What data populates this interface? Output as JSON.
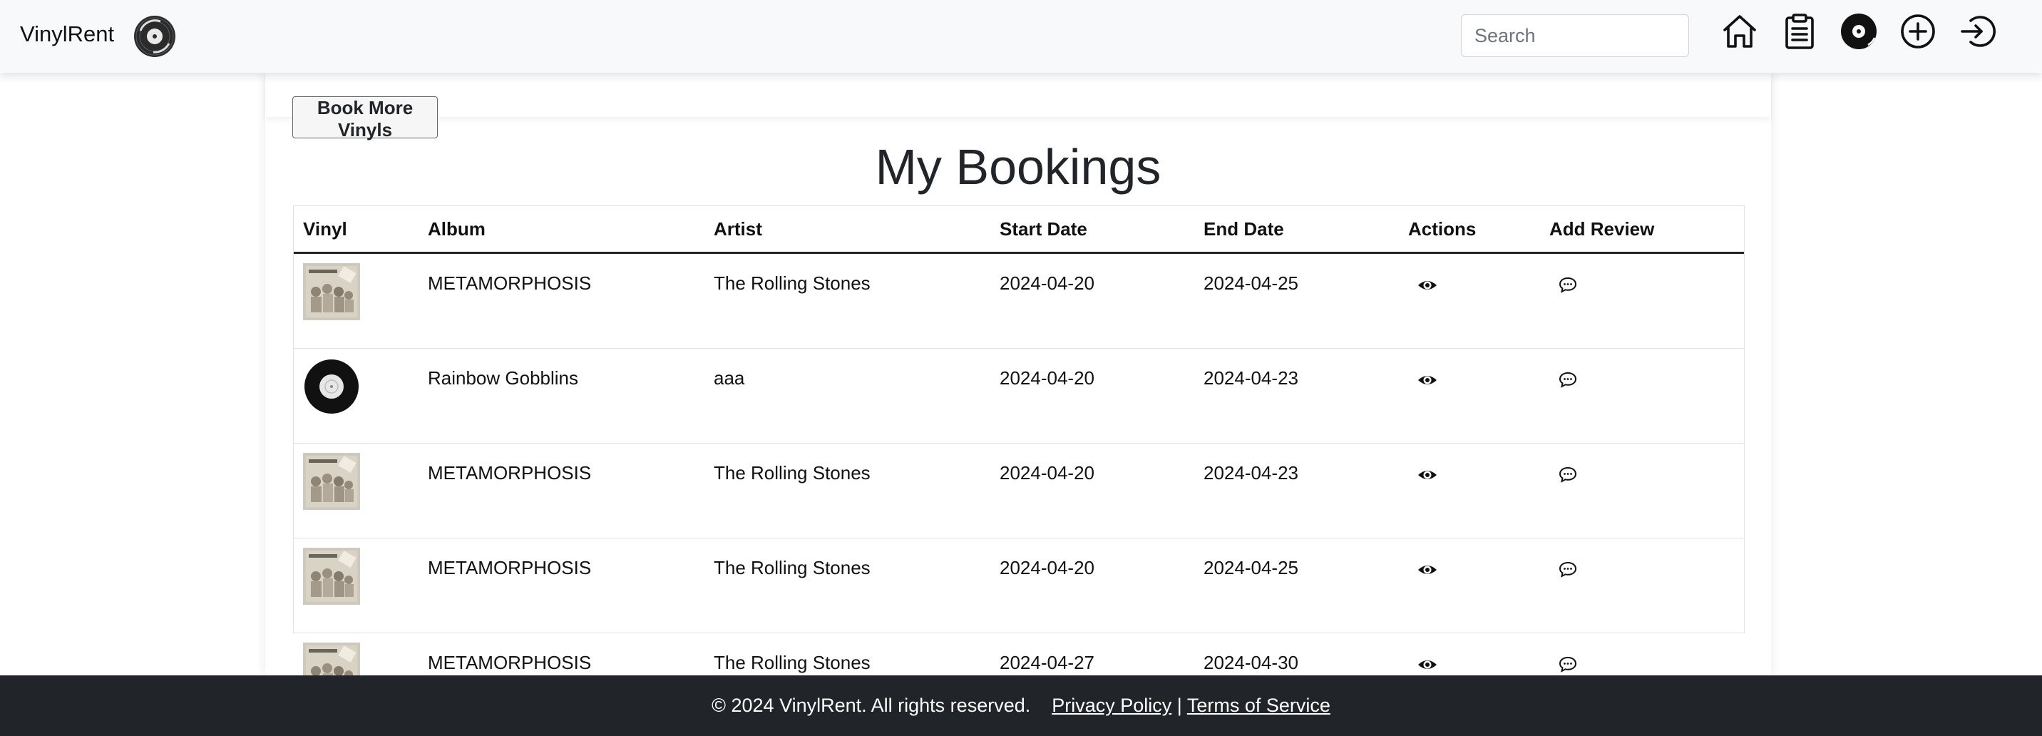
{
  "navbar": {
    "brand": "VinylRent",
    "search_placeholder": "Search",
    "icons": [
      "home-icon",
      "clipboard-icon",
      "vinyl-disc-icon",
      "plus-circle-icon",
      "login-icon"
    ]
  },
  "main": {
    "book_more_label": "Book More Vinyls",
    "title": "My Bookings",
    "table": {
      "headers": [
        "Vinyl",
        "Album",
        "Artist",
        "Start Date",
        "End Date",
        "Actions",
        "Add Review"
      ],
      "rows": [
        {
          "image": "album-cover",
          "album": "METAMORPHOSIS",
          "artist": "The Rolling Stones",
          "start": "2024-04-20",
          "end": "2024-04-25"
        },
        {
          "image": "vinyl-record",
          "album": "Rainbow Gobblins",
          "artist": "aaa",
          "start": "2024-04-20",
          "end": "2024-04-23"
        },
        {
          "image": "album-cover",
          "album": "METAMORPHOSIS",
          "artist": "The Rolling Stones",
          "start": "2024-04-20",
          "end": "2024-04-23"
        },
        {
          "image": "album-cover",
          "album": "METAMORPHOSIS",
          "artist": "The Rolling Stones",
          "start": "2024-04-20",
          "end": "2024-04-25"
        },
        {
          "image": "album-cover",
          "album": "METAMORPHOSIS",
          "artist": "The Rolling Stones",
          "start": "2024-04-27",
          "end": "2024-04-30"
        }
      ],
      "action_icon": "eye-icon",
      "review_icon": "chat-icon"
    }
  },
  "footer": {
    "copyright": "© 2024 VinylRent. All rights reserved.",
    "privacy": "Privacy Policy",
    "separator": "|",
    "terms": "Terms of Service"
  }
}
